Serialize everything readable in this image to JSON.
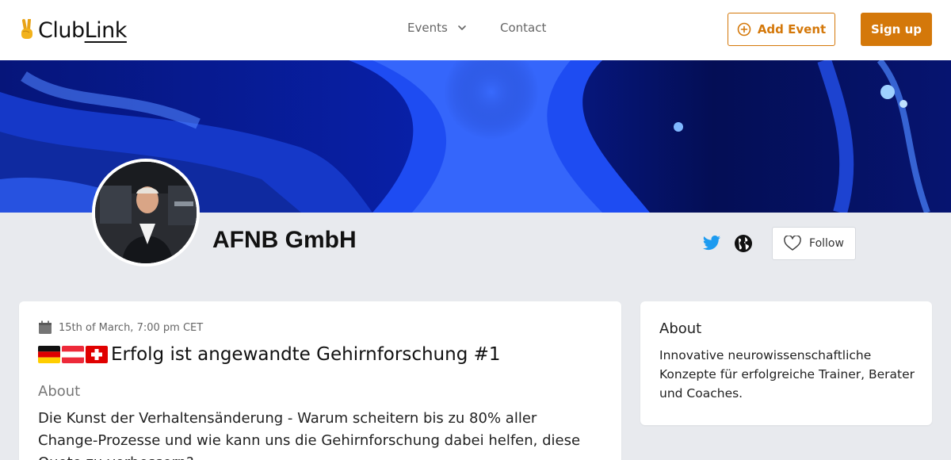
{
  "header": {
    "logo_text_1": "Club",
    "logo_text_2": "Link",
    "nav": {
      "events_label": "Events",
      "contact_label": "Contact"
    },
    "add_event_label": "Add Event",
    "sign_up_label": "Sign up"
  },
  "profile": {
    "org_name": "AFNB GmbH",
    "follow_label": "Follow"
  },
  "event": {
    "date": "15th of March, 7:00 pm CET",
    "title": "Erfolg ist angewandte Gehirnforschung #1",
    "flags": [
      "germany-flag",
      "austria-flag",
      "switzerland-flag"
    ],
    "about_label": "About",
    "about_text": "Die Kunst der Verhaltensänderung - Warum scheitern bis zu 80% aller Change-Prozesse und wie kann uns die Gehirnforschung dabei helfen, diese Quote zu verbessern?"
  },
  "sidebar": {
    "about_title": "About",
    "about_text": "Innovative neurowissenschaftliche Konzepte für erfolgreiche Trainer, Berater und Coaches."
  },
  "colors": {
    "accent": "#d4780a",
    "twitter": "#1d9bf0",
    "page_bg": "#e8eaee"
  }
}
